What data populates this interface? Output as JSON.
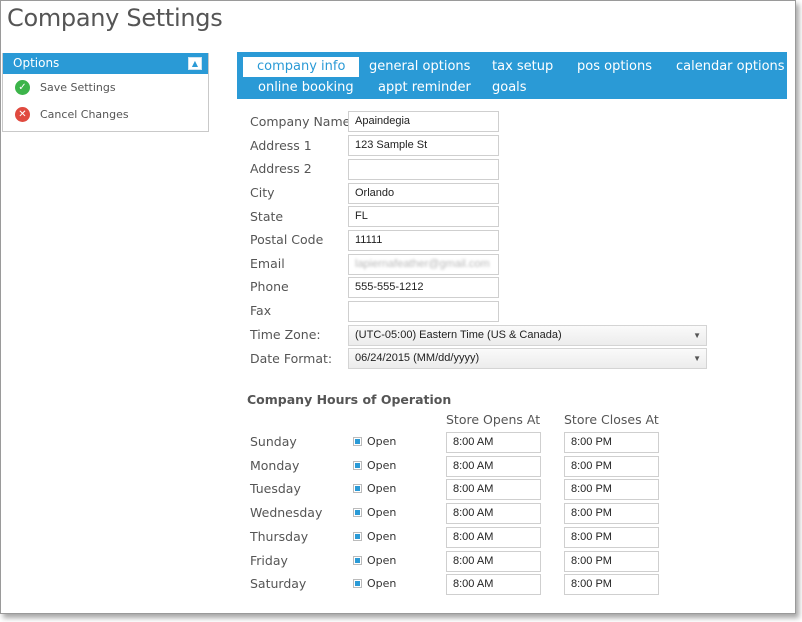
{
  "page": {
    "title": "Company Settings"
  },
  "sidebar": {
    "header": "Options",
    "items": [
      {
        "label": "Save Settings",
        "icon": "check-circle-icon"
      },
      {
        "label": "Cancel Changes",
        "icon": "x-circle-icon"
      }
    ]
  },
  "tabs": [
    {
      "label": "company info",
      "active": true
    },
    {
      "label": "general options"
    },
    {
      "label": "tax setup"
    },
    {
      "label": "pos options"
    },
    {
      "label": "calendar options"
    },
    {
      "label": "online booking"
    },
    {
      "label": "appt reminder"
    },
    {
      "label": "goals"
    }
  ],
  "form": {
    "company_name": {
      "label": "Company Name",
      "value": "Apaindegia"
    },
    "address1": {
      "label": "Address 1",
      "value": "123 Sample St"
    },
    "address2": {
      "label": "Address 2",
      "value": ""
    },
    "city": {
      "label": "City",
      "value": "Orlando"
    },
    "state": {
      "label": "State",
      "value": "FL"
    },
    "postal": {
      "label": "Postal Code",
      "value": "11111"
    },
    "email": {
      "label": "Email",
      "value": "lapiernafeather@gmail.com"
    },
    "phone": {
      "label": "Phone",
      "value": "555-555-1212"
    },
    "fax": {
      "label": "Fax",
      "value": ""
    },
    "timezone": {
      "label": "Time Zone:",
      "value": "(UTC-05:00) Eastern Time (US & Canada)"
    },
    "dateformat": {
      "label": "Date Format:",
      "value": "06/24/2015 (MM/dd/yyyy)"
    }
  },
  "hours": {
    "title": "Company Hours of Operation",
    "opens_header": "Store Opens At",
    "closes_header": "Store Closes At",
    "open_label": "Open",
    "days": [
      {
        "day": "Sunday",
        "open": "8:00 AM",
        "close": "8:00 PM"
      },
      {
        "day": "Monday",
        "open": "8:00 AM",
        "close": "8:00 PM"
      },
      {
        "day": "Tuesday",
        "open": "8:00 AM",
        "close": "8:00 PM"
      },
      {
        "day": "Wednesday",
        "open": "8:00 AM",
        "close": "8:00 PM"
      },
      {
        "day": "Thursday",
        "open": "8:00 AM",
        "close": "8:00 PM"
      },
      {
        "day": "Friday",
        "open": "8:00 AM",
        "close": "8:00 PM"
      },
      {
        "day": "Saturday",
        "open": "8:00 AM",
        "close": "8:00 PM"
      }
    ]
  },
  "colors": {
    "accent": "#2a9ad6",
    "ok": "#3cb44a",
    "cancel": "#e04a3f"
  }
}
